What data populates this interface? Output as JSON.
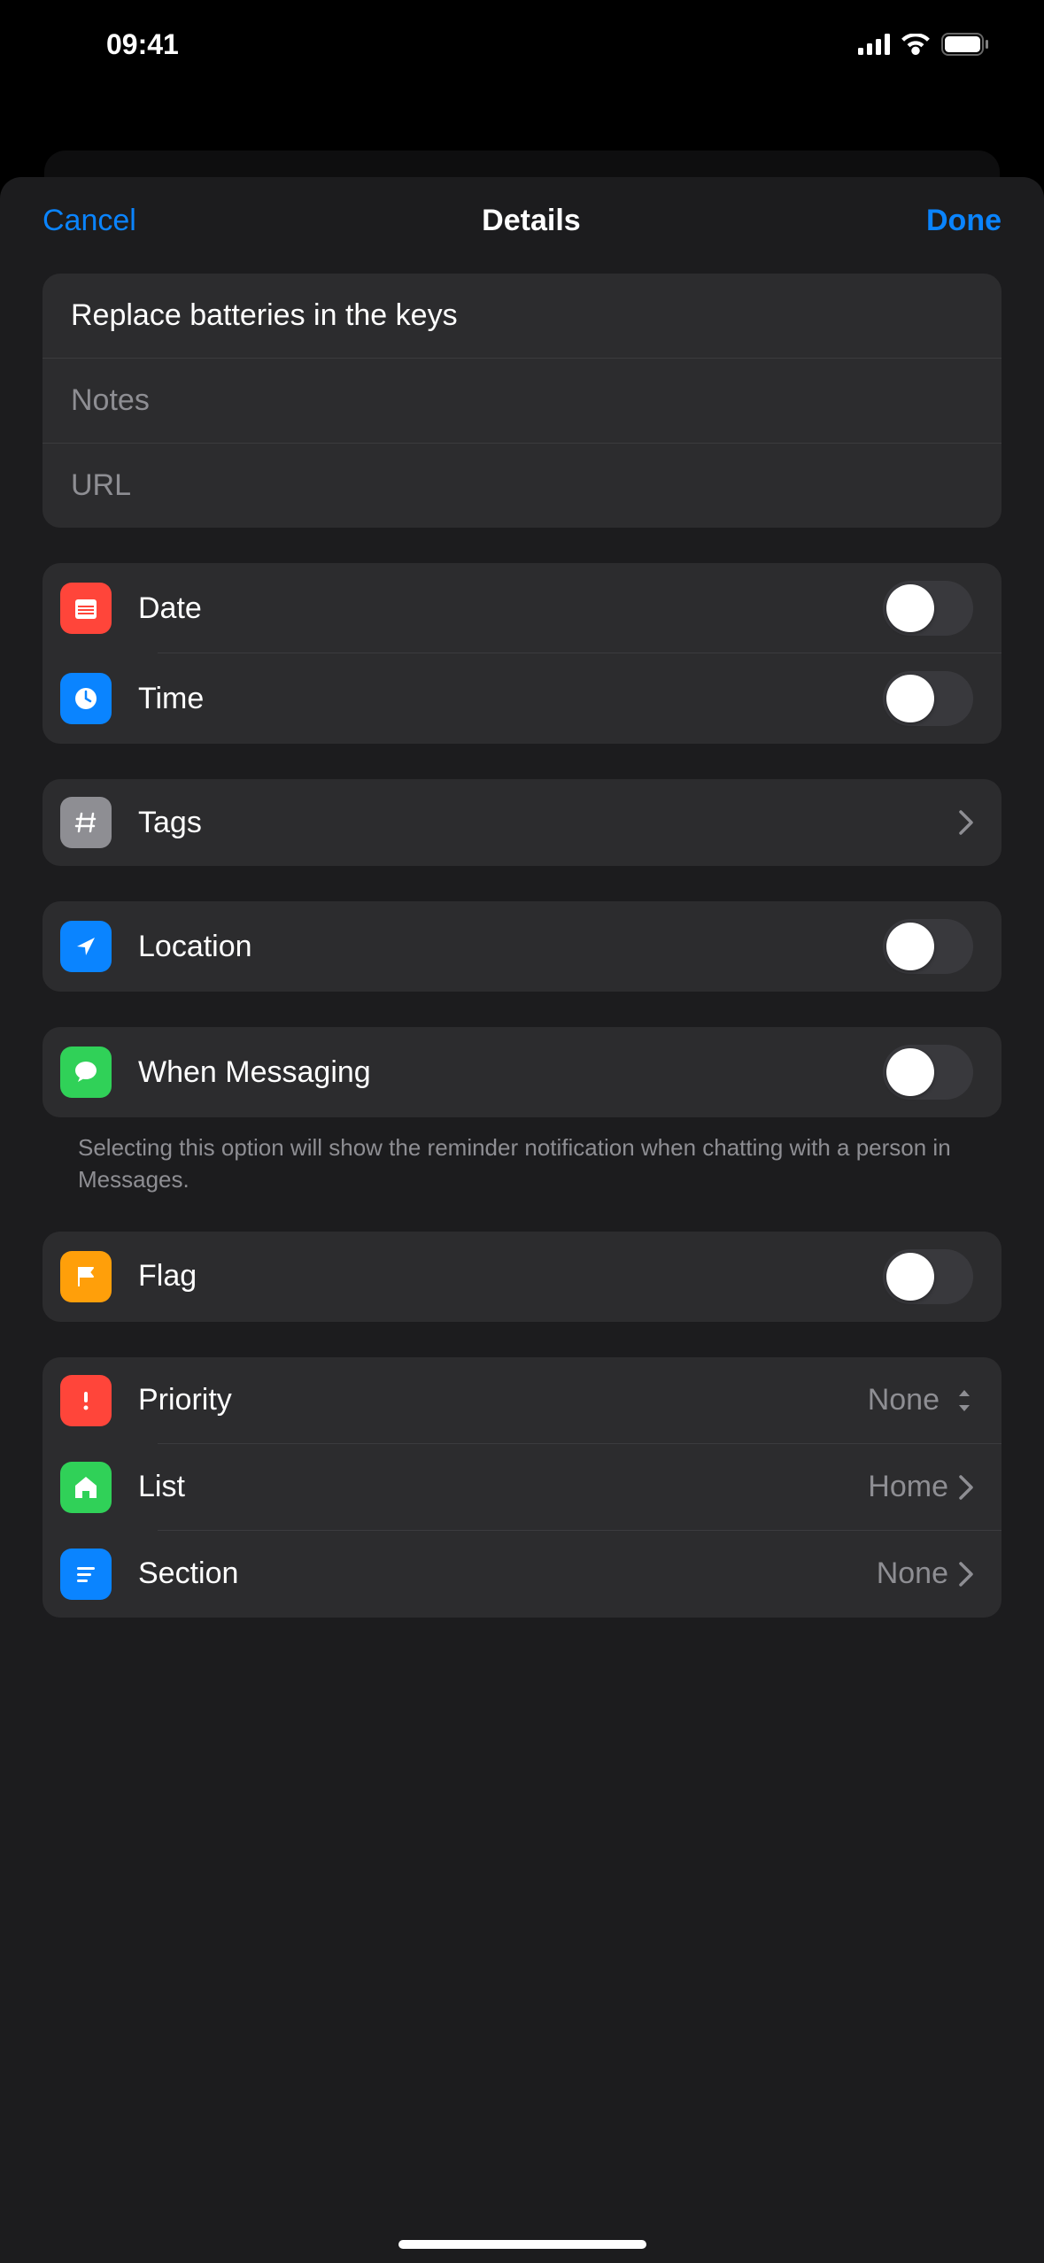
{
  "statusBar": {
    "time": "09:41"
  },
  "header": {
    "cancel": "Cancel",
    "title": "Details",
    "done": "Done"
  },
  "fields": {
    "titleValue": "Replace batteries in the keys",
    "notesPlaceholder": "Notes",
    "urlPlaceholder": "URL"
  },
  "rows": {
    "date": "Date",
    "time": "Time",
    "tags": "Tags",
    "location": "Location",
    "messaging": "When Messaging",
    "messagingFooter": "Selecting this option will show the reminder notification when chatting with a person in Messages.",
    "flag": "Flag",
    "priority": "Priority",
    "priorityValue": "None",
    "list": "List",
    "listValue": "Home",
    "section": "Section",
    "sectionValue": "None"
  }
}
